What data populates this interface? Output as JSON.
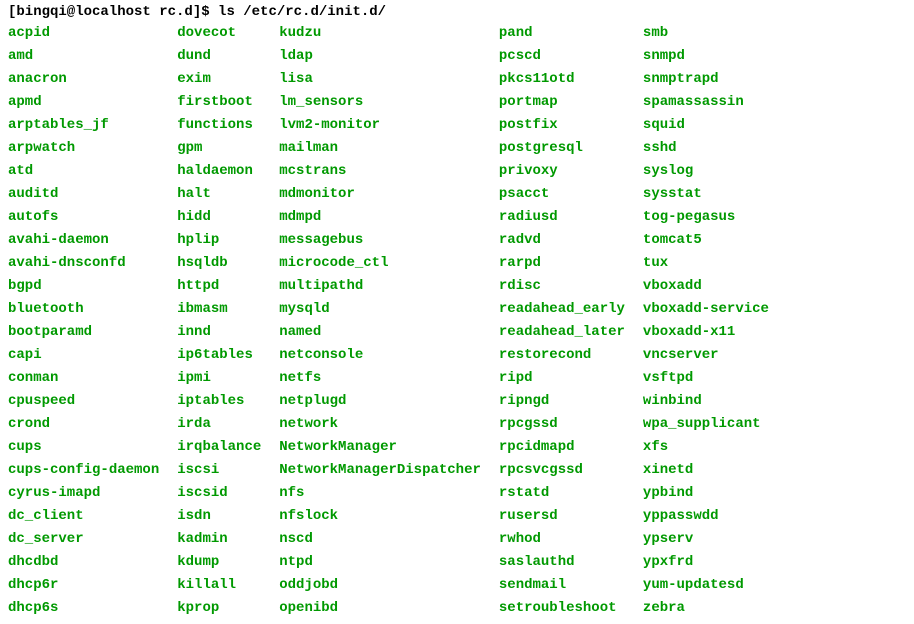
{
  "prompt": {
    "user_host_cwd": "[bingqi@localhost rc.d]$ ",
    "command": "ls /etc/rc.d/init.d/"
  },
  "columns": [
    {
      "entries": [
        "acpid",
        "amd",
        "anacron",
        "apmd",
        "arptables_jf",
        "arpwatch",
        "atd",
        "auditd",
        "autofs",
        "avahi-daemon",
        "avahi-dnsconfd",
        "bgpd",
        "bluetooth",
        "bootparamd",
        "capi",
        "conman",
        "cpuspeed",
        "crond",
        "cups",
        "cups-config-daemon",
        "cyrus-imapd",
        "dc_client",
        "dc_server",
        "dhcdbd",
        "dhcp6r",
        "dhcp6s"
      ]
    },
    {
      "entries": [
        "dovecot",
        "dund",
        "exim",
        "firstboot",
        "functions",
        "gpm",
        "haldaemon",
        "halt",
        "hidd",
        "hplip",
        "hsqldb",
        "httpd",
        "ibmasm",
        "innd",
        "ip6tables",
        "ipmi",
        "iptables",
        "irda",
        "irqbalance",
        "iscsi",
        "iscsid",
        "isdn",
        "kadmin",
        "kdump",
        "killall",
        "kprop"
      ]
    },
    {
      "entries": [
        "kudzu",
        "ldap",
        "lisa",
        "lm_sensors",
        "lvm2-monitor",
        "mailman",
        "mcstrans",
        "mdmonitor",
        "mdmpd",
        "messagebus",
        "microcode_ctl",
        "multipathd",
        "mysqld",
        "named",
        "netconsole",
        "netfs",
        "netplugd",
        "network",
        "NetworkManager",
        "NetworkManagerDispatcher",
        "nfs",
        "nfslock",
        "nscd",
        "ntpd",
        "oddjobd",
        "openibd"
      ]
    },
    {
      "entries": [
        "pand",
        "pcscd",
        "pkcs11otd",
        "portmap",
        "postfix",
        "postgresql",
        "privoxy",
        "psacct",
        "radiusd",
        "radvd",
        "rarpd",
        "rdisc",
        "readahead_early",
        "readahead_later",
        "restorecond",
        "ripd",
        "ripngd",
        "rpcgssd",
        "rpcidmapd",
        "rpcsvcgssd",
        "rstatd",
        "rusersd",
        "rwhod",
        "saslauthd",
        "sendmail",
        "setroubleshoot"
      ]
    },
    {
      "entries": [
        "smb",
        "snmpd",
        "snmptrapd",
        "spamassassin",
        "squid",
        "sshd",
        "syslog",
        "sysstat",
        "tog-pegasus",
        "tomcat5",
        "tux",
        "vboxadd",
        "vboxadd-service",
        "vboxadd-x11",
        "vncserver",
        "vsftpd",
        "winbind",
        "wpa_supplicant",
        "xfs",
        "xinetd",
        "ypbind",
        "yppasswdd",
        "ypserv",
        "ypxfrd",
        "yum-updatesd",
        "zebra"
      ]
    }
  ]
}
